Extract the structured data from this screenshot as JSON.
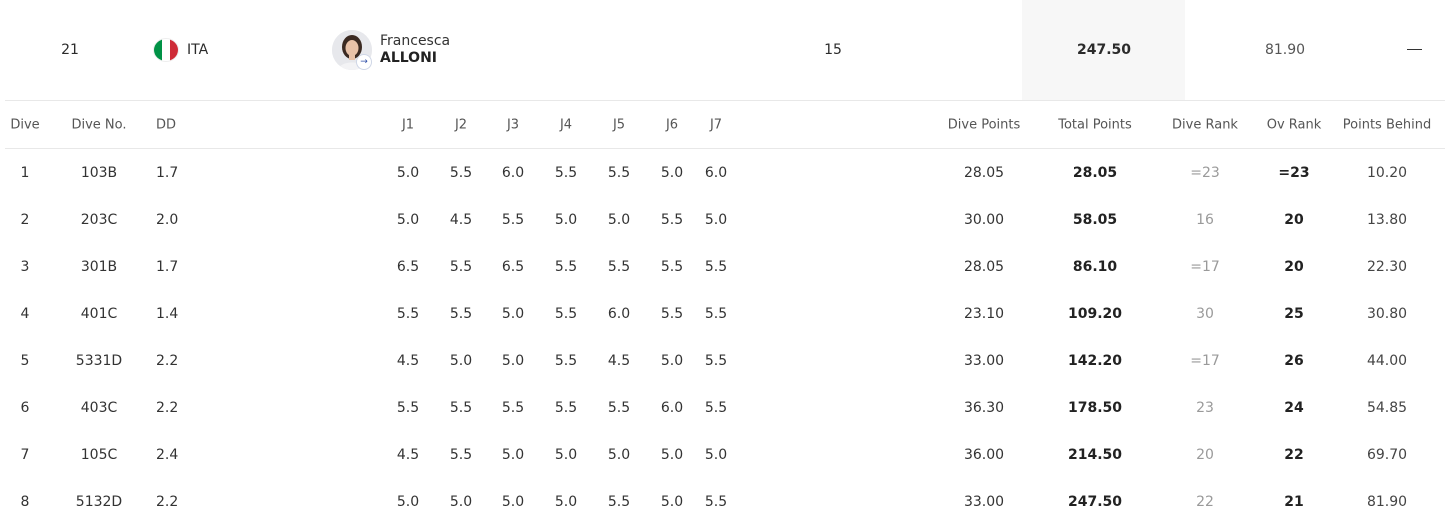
{
  "athlete": {
    "rank": "21",
    "country_code": "ITA",
    "flag_colors": [
      "#009246",
      "#ffffff",
      "#ce2b37"
    ],
    "flag_icon": "italy-flag-icon",
    "first_name": "Francesca",
    "last_name": "ALLONI",
    "dives": "15",
    "total": "247.50",
    "points_behind": "81.90",
    "expand_icon": "minus-icon"
  },
  "table": {
    "headers": {
      "dive": "Dive",
      "dive_no": "Dive No.",
      "dd": "DD",
      "j1": "J1",
      "j2": "J2",
      "j3": "J3",
      "j4": "J4",
      "j5": "J5",
      "j6": "J6",
      "j7": "J7",
      "dive_points": "Dive Points",
      "total_points": "Total Points",
      "dive_rank": "Dive Rank",
      "ov_rank": "Ov Rank",
      "points_behind": "Points Behind"
    },
    "rows": [
      {
        "dive": "1",
        "dive_no": "103B",
        "dd": "1.7",
        "judges": [
          "5.0",
          "5.5",
          "6.0",
          "5.5",
          "5.5",
          "5.0",
          "6.0"
        ],
        "dive_points": "28.05",
        "total_points": "28.05",
        "dive_rank": "=23",
        "ov_rank": "=23",
        "points_behind": "10.20"
      },
      {
        "dive": "2",
        "dive_no": "203C",
        "dd": "2.0",
        "judges": [
          "5.0",
          "4.5",
          "5.5",
          "5.0",
          "5.0",
          "5.5",
          "5.0"
        ],
        "dive_points": "30.00",
        "total_points": "58.05",
        "dive_rank": "16",
        "ov_rank": "20",
        "points_behind": "13.80"
      },
      {
        "dive": "3",
        "dive_no": "301B",
        "dd": "1.7",
        "judges": [
          "6.5",
          "5.5",
          "6.5",
          "5.5",
          "5.5",
          "5.5",
          "5.5"
        ],
        "dive_points": "28.05",
        "total_points": "86.10",
        "dive_rank": "=17",
        "ov_rank": "20",
        "points_behind": "22.30"
      },
      {
        "dive": "4",
        "dive_no": "401C",
        "dd": "1.4",
        "judges": [
          "5.5",
          "5.5",
          "5.0",
          "5.5",
          "6.0",
          "5.5",
          "5.5"
        ],
        "dive_points": "23.10",
        "total_points": "109.20",
        "dive_rank": "30",
        "ov_rank": "25",
        "points_behind": "30.80"
      },
      {
        "dive": "5",
        "dive_no": "5331D",
        "dd": "2.2",
        "judges": [
          "4.5",
          "5.0",
          "5.0",
          "5.5",
          "4.5",
          "5.0",
          "5.5"
        ],
        "dive_points": "33.00",
        "total_points": "142.20",
        "dive_rank": "=17",
        "ov_rank": "26",
        "points_behind": "44.00"
      },
      {
        "dive": "6",
        "dive_no": "403C",
        "dd": "2.2",
        "judges": [
          "5.5",
          "5.5",
          "5.5",
          "5.5",
          "5.5",
          "6.0",
          "5.5"
        ],
        "dive_points": "36.30",
        "total_points": "178.50",
        "dive_rank": "23",
        "ov_rank": "24",
        "points_behind": "54.85"
      },
      {
        "dive": "7",
        "dive_no": "105C",
        "dd": "2.4",
        "judges": [
          "4.5",
          "5.5",
          "5.0",
          "5.0",
          "5.0",
          "5.0",
          "5.0"
        ],
        "dive_points": "36.00",
        "total_points": "214.50",
        "dive_rank": "20",
        "ov_rank": "22",
        "points_behind": "69.70"
      },
      {
        "dive": "8",
        "dive_no": "5132D",
        "dd": "2.2",
        "judges": [
          "5.0",
          "5.0",
          "5.0",
          "5.0",
          "5.5",
          "5.0",
          "5.5"
        ],
        "dive_points": "33.00",
        "total_points": "247.50",
        "dive_rank": "22",
        "ov_rank": "21",
        "points_behind": "81.90"
      }
    ]
  }
}
